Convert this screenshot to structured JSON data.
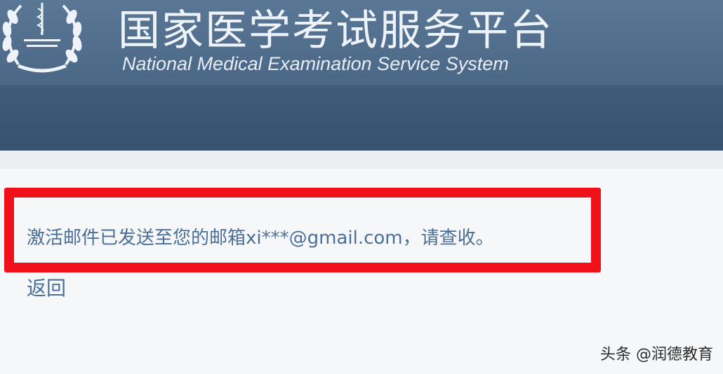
{
  "header": {
    "title_cn": "国家医学考试服务平台",
    "title_en": "National Medical Examination Service System",
    "logo_icon": "medical-emblem-laurel-icon"
  },
  "main": {
    "message": "激活邮件已发送至您的邮箱xi***@gmail.com，请查收。",
    "back_link": "返回"
  },
  "watermark": {
    "text": "头条 @润德教育"
  },
  "colors": {
    "header_bg": "#4e6a89",
    "link_text": "#4a6f98",
    "highlight_border": "#f0101a"
  }
}
